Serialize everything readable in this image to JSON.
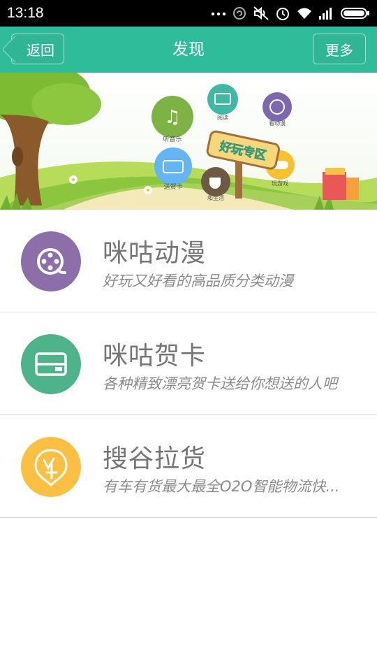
{
  "status_bar": {
    "time": "13:18",
    "icons": [
      "more-dots-icon",
      "sync-icon",
      "mute-icon",
      "alarm-icon",
      "wifi-icon",
      "signal-icon",
      "battery-icon"
    ]
  },
  "nav": {
    "back_label": "返回",
    "title": "发现",
    "more_label": "更多",
    "bar_color": "#2ebc9b"
  },
  "banner": {
    "sign_text": "好玩专区",
    "bubbles": [
      {
        "label": "听音乐",
        "icon": "music-note-icon",
        "color": "#7cb342"
      },
      {
        "label": "阅读",
        "icon": "book-icon",
        "color": "#3fb9a4"
      },
      {
        "label": "看动漫",
        "icon": "film-reel-icon",
        "color": "#7b68ae"
      },
      {
        "label": "送贺卡",
        "icon": "card-icon",
        "color": "#64b5f6"
      },
      {
        "label": "和生活",
        "icon": "coffee-cup-icon",
        "color": "#6d5a44"
      },
      {
        "label": "玩游戏",
        "icon": "gamepad-icon",
        "color": "#fbc02d"
      }
    ]
  },
  "items": [
    {
      "title": "咪咕动漫",
      "desc": "好玩又好看的高品质分类动漫",
      "icon": "film-reel-icon",
      "color": "#8c6fa9"
    },
    {
      "title": "咪咕贺卡",
      "desc": "各种精致漂亮贺卡送给你想送的人吧",
      "icon": "card-icon",
      "color": "#4db38a"
    },
    {
      "title": "搜谷拉货",
      "desc": "有车有货最大最全O2O智能物流快...",
      "icon": "cargo-badge-icon",
      "color": "#fbc042"
    }
  ]
}
